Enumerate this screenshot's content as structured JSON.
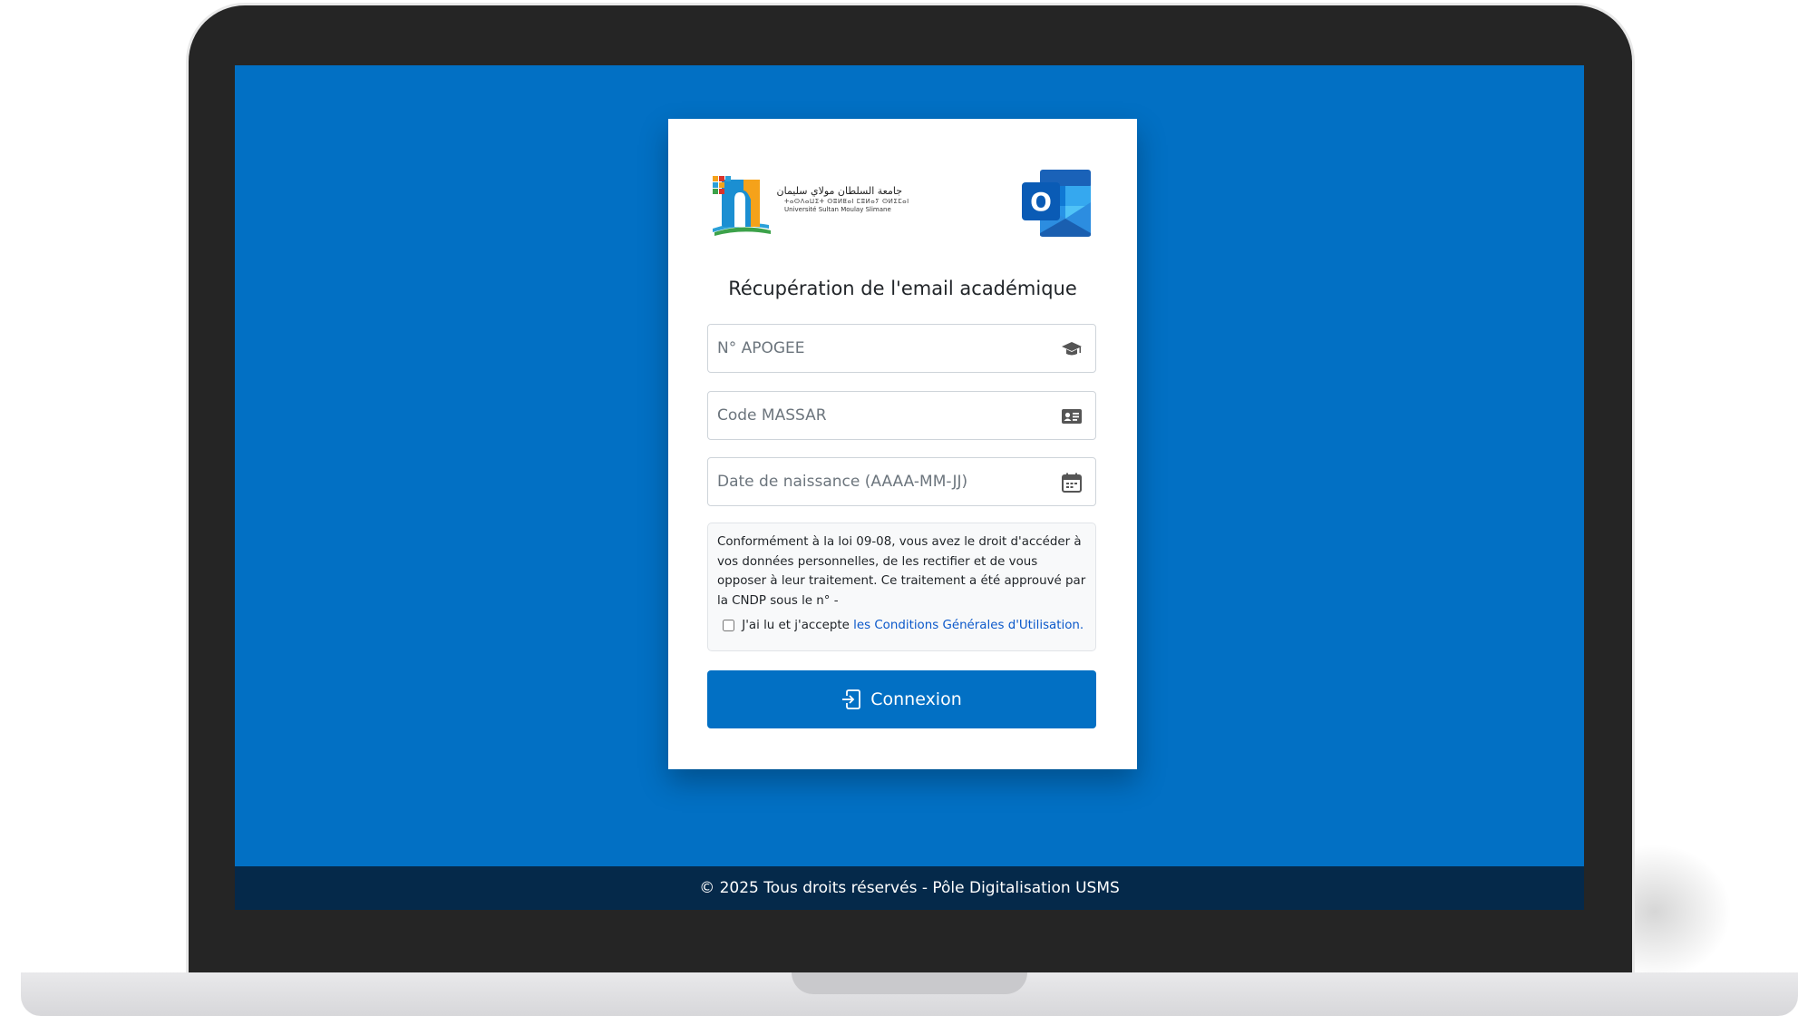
{
  "card": {
    "logo": {
      "arabic": "جامعة السلطان مولاي سليمان",
      "tifinagh": "ⵜⴰⵙⴷⴰⵡⵉⵜ ⵙⵓⵍⵟⴰⵏ ⵎⵓⵍⴰⵢ ⵙⵍⵉⵎⴰⵏ",
      "french": "Université Sultan Moulay Slimane"
    },
    "outlook_icon": "outlook-logo",
    "title": "Récupération de l'email académique",
    "fields": {
      "apogee": {
        "placeholder": "N° APOGEE",
        "value": "",
        "icon": "graduation-cap-icon"
      },
      "massar": {
        "placeholder": "Code MASSAR",
        "value": "",
        "icon": "id-card-icon"
      },
      "birthdate": {
        "placeholder": "Date de naissance (AAAA-MM-JJ)",
        "value": "",
        "icon": "calendar-icon"
      }
    },
    "notice": {
      "text": "Conformément à la loi 09-08, vous avez le droit d'accéder à vos données personnelles, de les rectifier et de vous opposer à leur traitement. Ce traitement a été approuvé par la CNDP sous le n° -",
      "terms_prefix": "J'ai lu et j'accepte",
      "terms_link": "les Conditions Générales d'Utilisation.",
      "terms_checked": false
    },
    "submit": {
      "label": "Connexion",
      "icon": "sign-in-icon"
    }
  },
  "footer": {
    "text": "© 2025 Tous droits réservés - Pôle Digitalisation USMS"
  },
  "colors": {
    "screen_bg": "#0270c4",
    "button_bg": "#0270c4",
    "footer_bg": "#05294a",
    "link": "#0a58ca",
    "laptop_bezel": "#252525"
  }
}
